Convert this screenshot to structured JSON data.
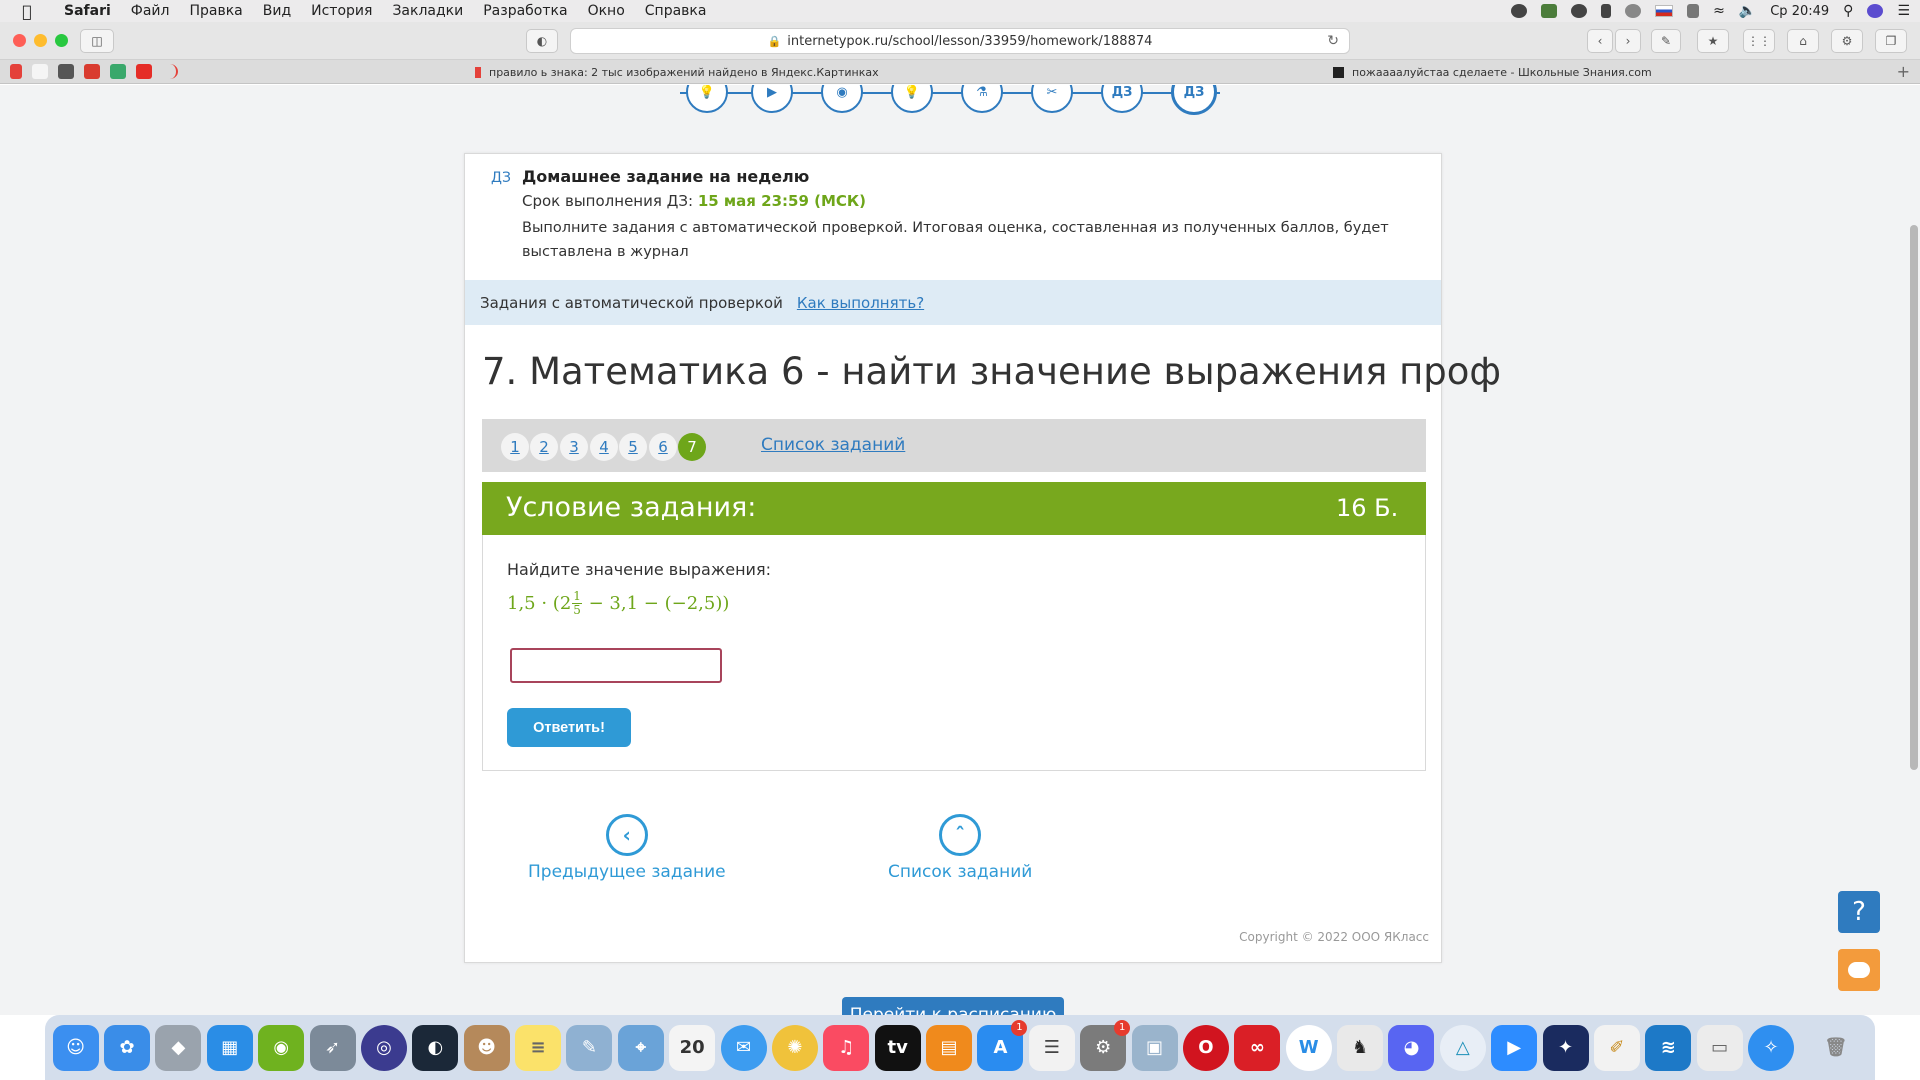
{
  "menubar": {
    "app": "Safari",
    "items": [
      "Файл",
      "Правка",
      "Вид",
      "История",
      "Закладки",
      "Разработка",
      "Окно",
      "Справка"
    ],
    "clock": "Ср 20:49"
  },
  "browser": {
    "url": "internetурок.ru/school/lesson/33959/homework/188874",
    "tabs": [
      {
        "title": "правило ь знака: 2 тыс изображений найдено в Яндекс.Картинках"
      },
      {
        "title": "пожаааалуйстаа сделаете - Школьные Знания.com"
      }
    ]
  },
  "stepper": {
    "steps": [
      "💡",
      "▶",
      "◉",
      "💡",
      "⚗",
      "✂",
      "ДЗ",
      "ДЗ"
    ]
  },
  "homework": {
    "tag": "ДЗ",
    "title": "Домашнее задание на неделю",
    "deadline_label": "Срок выполнения ДЗ:",
    "deadline_date": "15 мая 23:59 (МСК)",
    "description": "Выполните задания с автоматической проверкой. Итоговая оценка, составленная из полученных баллов, будет выставлена в журнал"
  },
  "auto_check": {
    "label": "Задания с автоматической проверкой",
    "how_link": "Как выполнять?"
  },
  "task": {
    "title": "7. Математика 6 - найти значение выражения проф",
    "nav_numbers": [
      "1",
      "2",
      "3",
      "4",
      "5",
      "6",
      "7"
    ],
    "active": "7",
    "list_link": "Список заданий",
    "condition_header": "Условие задания:",
    "points": "16 Б.",
    "prompt": "Найдите значение выражения:",
    "expr_prefix": "1,5 · (2",
    "frac_num": "1",
    "frac_den": "5",
    "expr_suffix": " − 3,1 − (−2,5))",
    "answer_value": "",
    "submit_label": "Ответить!"
  },
  "bottom_nav": {
    "prev_label": "Предыдущее задание",
    "list_label": "Список заданий"
  },
  "copyright": "Copyright © 2022 ООО ЯКласс",
  "schedule_button": "Перейти к расписанию",
  "colors": {
    "accent_blue": "#2f7bbf",
    "green": "#78a81e",
    "submit_blue": "#2f9ad6"
  }
}
